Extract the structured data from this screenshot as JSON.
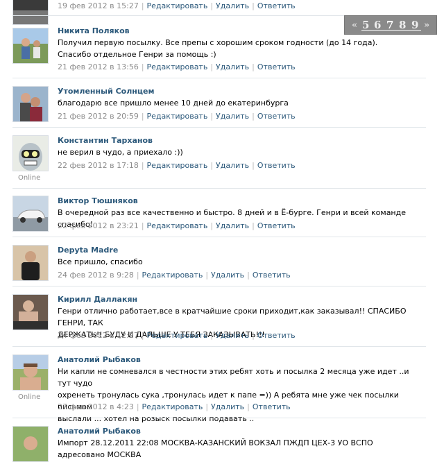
{
  "pager": {
    "prev": "«",
    "pages": [
      "5",
      "6",
      "7",
      "8",
      "9"
    ],
    "current": "7",
    "next": "»"
  },
  "actions": {
    "edit": "Редактировать",
    "delete": "Удалить",
    "reply": "Ответить"
  },
  "online_label": "Online",
  "colors": {
    "link": "#2b587a",
    "meta": "#8c8c8c",
    "divider": "#e1e6ea",
    "pager_bg": "#8a8a8a"
  },
  "posts": [
    {
      "author": "",
      "text": [],
      "date": "19 фев 2012 в 15:27",
      "online": false
    },
    {
      "author": "Никита Поляков",
      "text": [
        "Получил первую посылку. Все препы с хорошим сроком годности (до 14 года).",
        "Спасибо отдельное Генри за помощь :)"
      ],
      "date": "21 фев 2012 в 13:56",
      "online": false
    },
    {
      "author": "Утомленный Солнцем",
      "text": [
        "благодарю все пришло менее 10 дней до екатеринбурга"
      ],
      "date": "21 фев 2012 в 20:59",
      "online": false
    },
    {
      "author": "Константин Тарханов",
      "text": [
        "не верил в чудо, а приехало :))"
      ],
      "date": "22 фев 2012 в 17:18",
      "online": true
    },
    {
      "author": "Виктор Тюшняков",
      "text": [
        "В очередной раз все качественно и быстро. 8 дней и в Ё-бурге. Генри и всей команде спасибо!"
      ],
      "date": "22 фев 2012 в 23:21",
      "online": false
    },
    {
      "author": "Depyta Madre",
      "text": [
        "Все пришло, спасибо"
      ],
      "date": "24 фев 2012 в 9:28",
      "online": false
    },
    {
      "author": "Кирилл Даллакян",
      "text": [
        "Генри отлично работает,все в кратчайшие сроки приходит,как заказывал!! СПАСИБО ГЕНРИ, ТАК",
        "ДЕРЖАТЬ!! БУДУ И ДАЛЬШЕ У ТЕБЯ ЗАКАЗЫВАТЬ!!!"
      ],
      "date": "24 фев 2012 в 12:27",
      "online": false
    },
    {
      "author": "Анатолий Рыбаков",
      "text": [
        "Ни капли не сомневался в честности этих ребят хоть и посылка 2 месяца уже идет ..и тут чудо",
        "охренеть тронулась сука ,тронулась идет к папе =)) А ребята мне уже чек посылки письмом",
        "выслали ... хотел на розыск посылки подавать .."
      ],
      "date": "27 фев 2012 в 4:23",
      "online": true
    },
    {
      "author": "Анатолий Рыбаков",
      "text": [
        "Импорт 28.12.2011 22:08 МОСКВА-КАЗАНСКИЙ ВОКЗАЛ ПЖДП ЦЕХ-3 УО ВСПО адресовано МОСКВА"
      ],
      "date": "",
      "online": false
    }
  ]
}
